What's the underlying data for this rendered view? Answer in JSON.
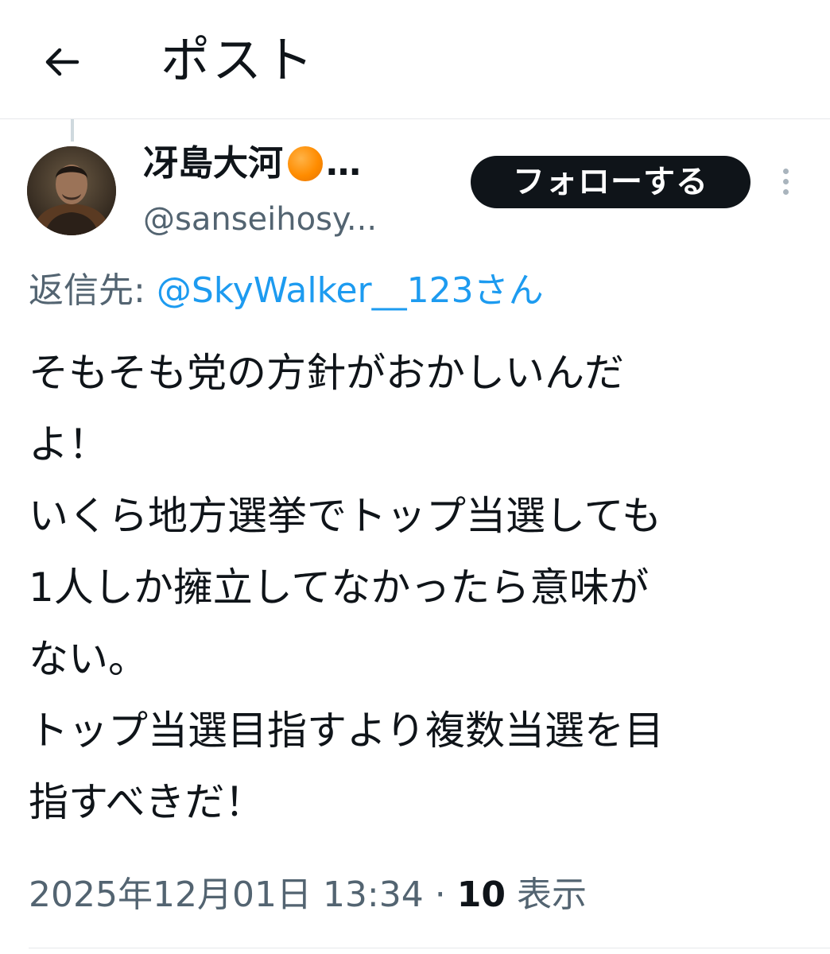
{
  "header": {
    "title": "ポスト",
    "back_icon": "arrow-left-icon"
  },
  "author": {
    "name": "冴島大河",
    "name_emoji": "orange-circle-emoji",
    "name_ellipsis": "…",
    "handle": "@sanseihosy...",
    "avatar_icon": "avatar-photo"
  },
  "actions": {
    "follow_label": "フォローする",
    "more_icon": "more-vertical-icon"
  },
  "reply_to": {
    "prefix": "返信先: ",
    "mention": "@SkyWalker__123さん"
  },
  "post": {
    "lines": [
      "そもそも党の方針がおかしいんだ",
      "よ！",
      "いくら地方選挙でトップ当選しても",
      "1人しか擁立してなかったら意味が",
      "ない。",
      "トップ当選目指すより複数当選を目",
      "指すべきだ！"
    ]
  },
  "meta": {
    "timestamp": "2025年12月01日 13:34",
    "separator": " · ",
    "views_count": "10",
    "views_label": " 表示"
  },
  "colors": {
    "text_primary": "#0f1419",
    "text_secondary": "#536471",
    "link": "#1d9bf0",
    "button_bg": "#0f1419",
    "divider": "#e6e8ea"
  }
}
